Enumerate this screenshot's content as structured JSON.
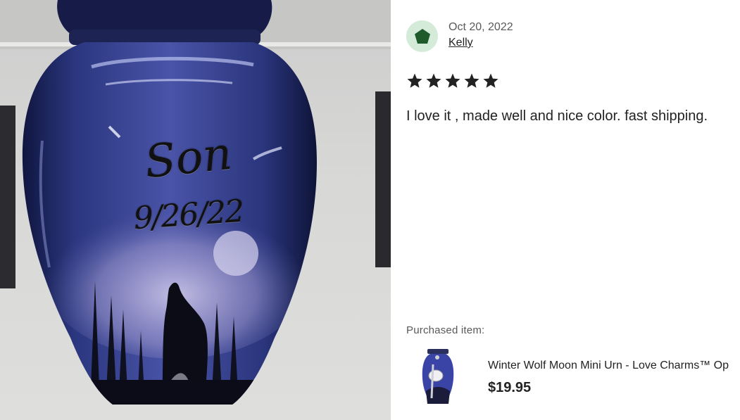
{
  "photo": {
    "engraving_name": "Son",
    "engraving_date": "9/26/22"
  },
  "review": {
    "date": "Oct 20, 2022",
    "reviewer": "Kelly",
    "rating": 5,
    "text": "I love it , made well and nice color. fast shipping.",
    "avatar_color": "#d5ebd9",
    "avatar_shape_color": "#1e5a2a"
  },
  "purchased": {
    "label": "Purchased item:",
    "title": "Winter Wolf Moon Mini Urn - Love Charms™ Op",
    "price": "$19.95"
  }
}
